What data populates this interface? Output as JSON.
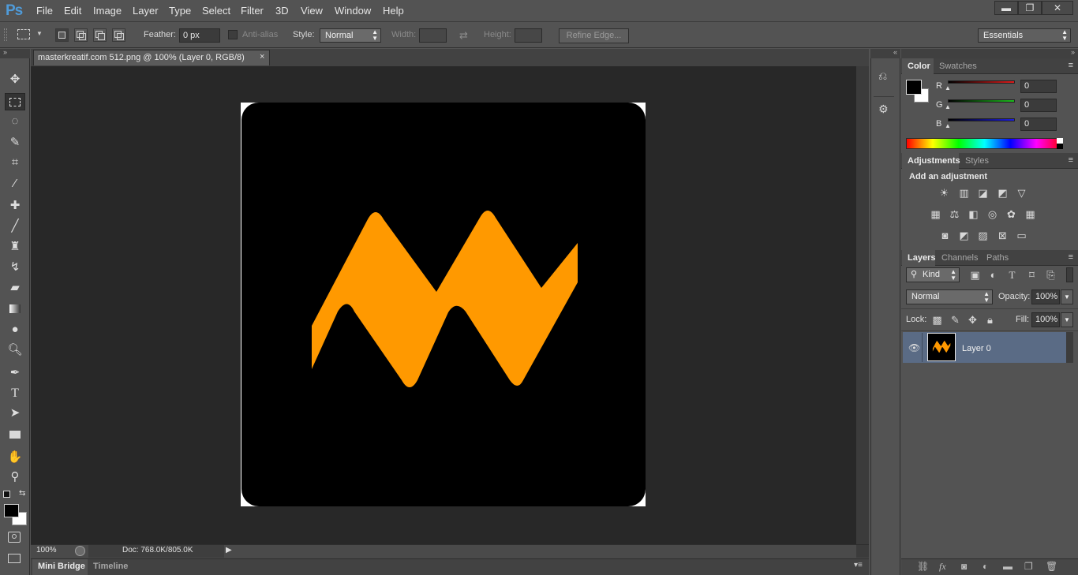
{
  "app": {
    "logo": "Ps",
    "menu": [
      "File",
      "Edit",
      "Image",
      "Layer",
      "Type",
      "Select",
      "Filter",
      "3D",
      "View",
      "Window",
      "Help"
    ],
    "window_buttons": {
      "minimize": "▬",
      "restore": "❐",
      "close": "✕"
    }
  },
  "options": {
    "feather_label": "Feather:",
    "feather_value": "0 px",
    "antialias_label": "Anti-alias",
    "style_label": "Style:",
    "style_value": "Normal",
    "width_label": "Width:",
    "height_label": "Height:",
    "refine_label": "Refine Edge...",
    "workspace": "Essentials"
  },
  "document": {
    "tab_title": "masterkreatif.com 512.png @ 100% (Layer 0, RGB/8)",
    "close_glyph": "×",
    "zoom": "100%",
    "doc_info": "Doc: 768.0K/805.0K",
    "bottom_tabs": [
      "Mini Bridge",
      "Timeline"
    ]
  },
  "artwork": {
    "background_color": "#000000",
    "mark_color": "#ff9900",
    "border_color": "#ffffff"
  },
  "color_panel": {
    "tabs": [
      "Color",
      "Swatches"
    ],
    "channels": [
      {
        "label": "R",
        "value": "0",
        "color": "#d21d1d"
      },
      {
        "label": "G",
        "value": "0",
        "color": "#1db41d"
      },
      {
        "label": "B",
        "value": "0",
        "color": "#1d1dd2"
      }
    ],
    "foreground": "#000000",
    "background": "#ffffff"
  },
  "adjustments_panel": {
    "tabs": [
      "Adjustments",
      "Styles"
    ],
    "heading": "Add an adjustment"
  },
  "layers_panel": {
    "tabs": [
      "Layers",
      "Channels",
      "Paths"
    ],
    "filter_kind": "Kind",
    "blend_mode": "Normal",
    "opacity_label": "Opacity:",
    "opacity_value": "100%",
    "lock_label": "Lock:",
    "fill_label": "Fill:",
    "fill_value": "100%",
    "layers": [
      {
        "name": "Layer 0",
        "visible": true
      }
    ]
  }
}
